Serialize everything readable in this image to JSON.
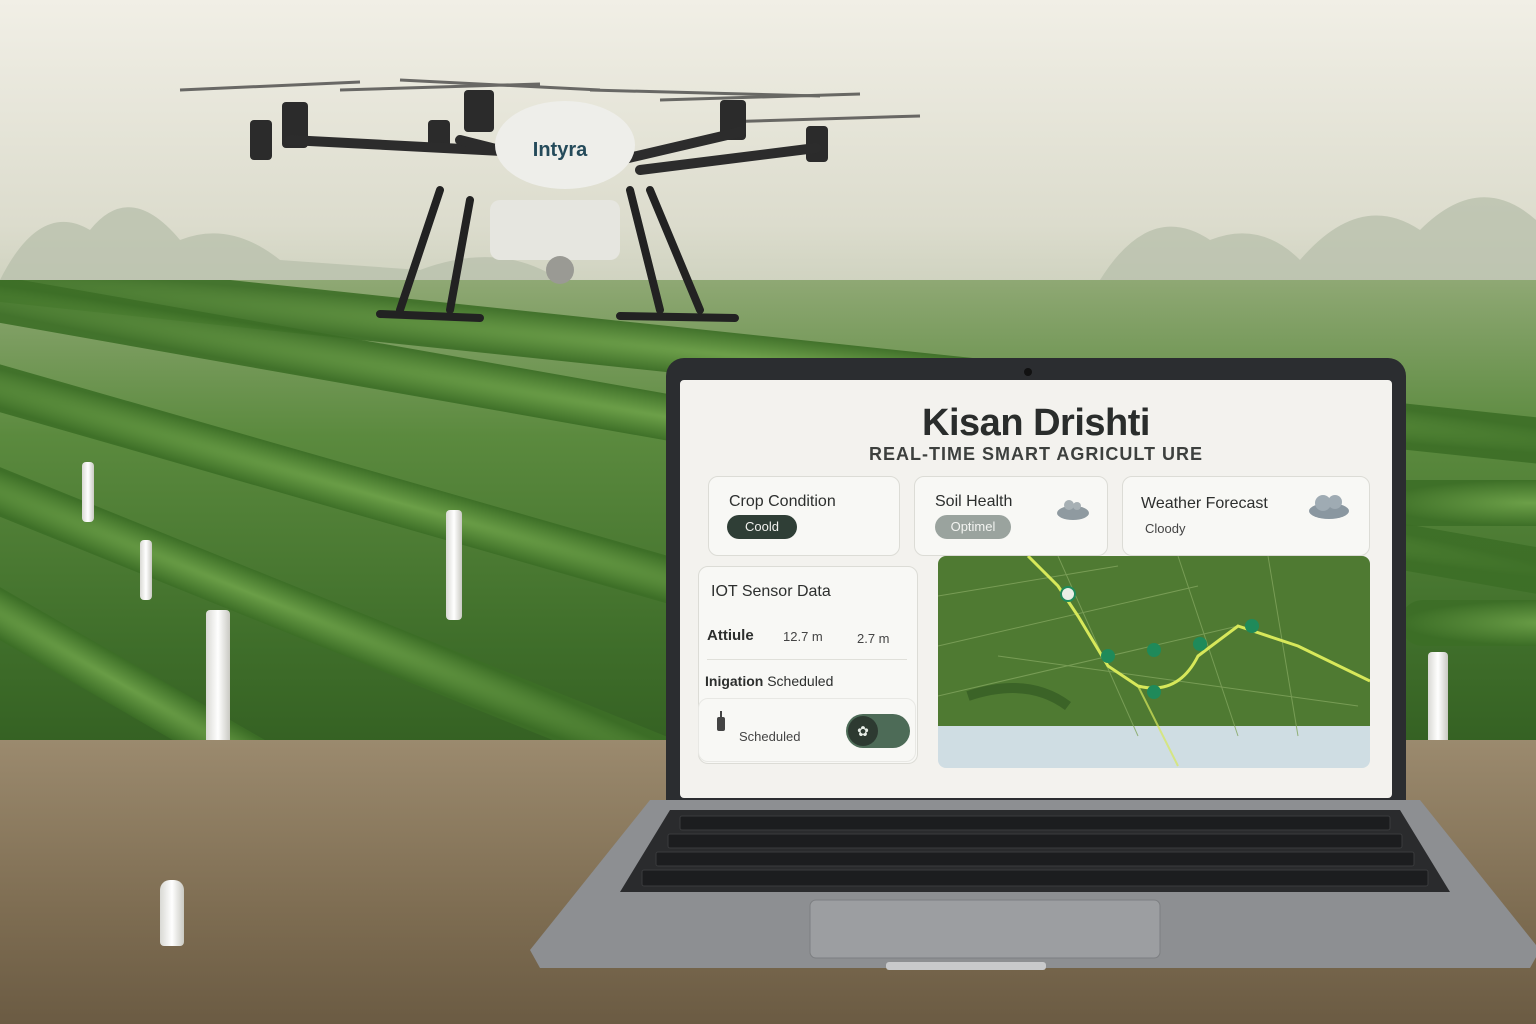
{
  "drone": {
    "brand_text": "Intyra"
  },
  "app": {
    "title": "Kisan Drishti",
    "subtitle": "REAL-TIME SMART AGRICULT URE"
  },
  "cards": {
    "crop": {
      "title": "Crop Condition",
      "status": "Coold"
    },
    "soil": {
      "title": "Soil Health",
      "status": "Optimel"
    },
    "weather": {
      "title": "Weather Forecast",
      "status": "Cloody"
    }
  },
  "iot": {
    "title": "IOT Sensor Data",
    "metric_label": "Attiule",
    "value_1": "12.7 m",
    "value_2": "2.7 m",
    "irrigation_label_bold": "Inigation",
    "irrigation_label_rest": "Scheduled",
    "toggle_status": "Scheduled"
  },
  "colors": {
    "accent_dark": "#2f3e36",
    "map_green": "#4f7a32",
    "route_yellow": "#d7e85a",
    "marker_teal": "#1f8a5a"
  },
  "icons": {
    "soil": "soil-icon",
    "weather": "cloud-icon",
    "sensor": "sensor-icon",
    "toggle": "leaf-icon"
  }
}
